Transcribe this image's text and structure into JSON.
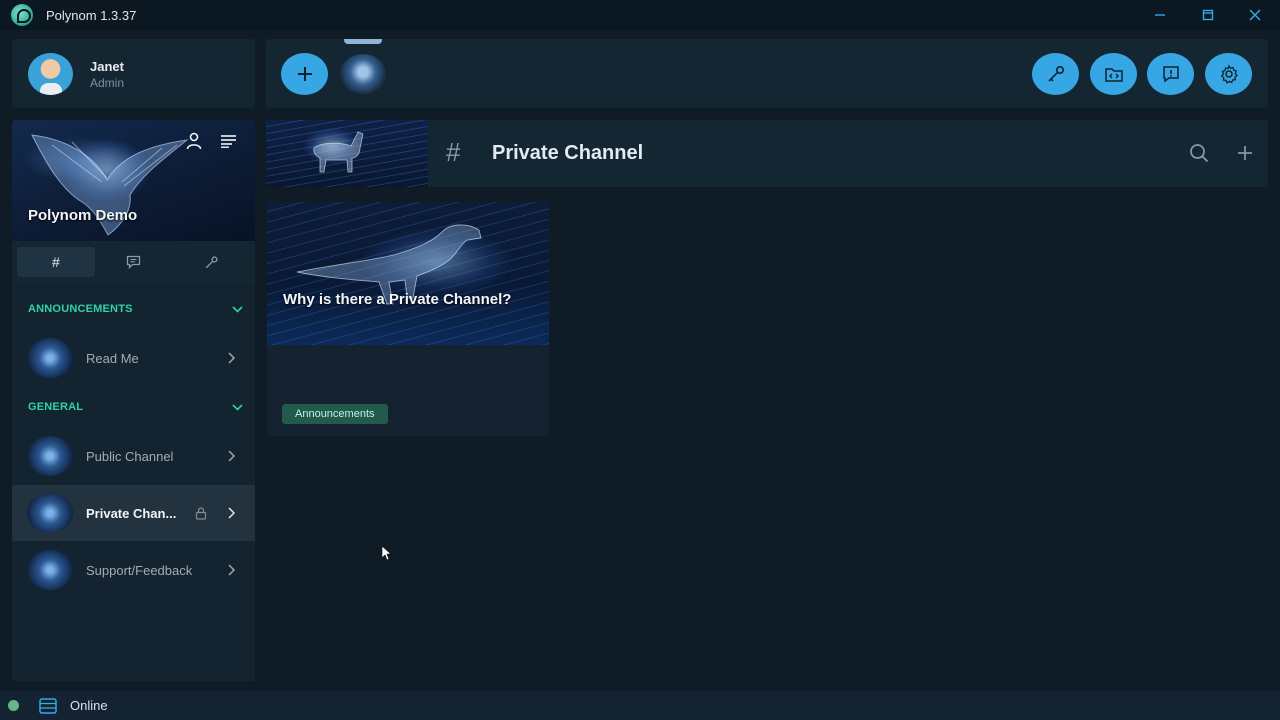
{
  "app": {
    "title": "Polynom 1.3.37",
    "window_controls": [
      "minimize-icon",
      "maximize-icon",
      "close-icon"
    ]
  },
  "profile": {
    "name": "Janet",
    "role": "Admin"
  },
  "topbar": {
    "left_buttons": [
      "plus-icon"
    ],
    "right_buttons": [
      "key-icon",
      "folder-code-icon",
      "feedback-icon",
      "gear-icon"
    ]
  },
  "server": {
    "name": "Polynom Demo",
    "banner_icons": [
      "user-icon",
      "menu-icon"
    ],
    "tabs": [
      {
        "icon": "hash-icon",
        "label": "#",
        "active": true
      },
      {
        "icon": "chat-icon",
        "label": "",
        "active": false
      },
      {
        "icon": "key-icon",
        "label": "",
        "active": false
      }
    ]
  },
  "sidebar": {
    "categories": [
      {
        "name": "ANNOUNCEMENTS",
        "channels": [
          {
            "label": "Read Me",
            "active": false,
            "locked": false
          }
        ]
      },
      {
        "name": "GENERAL",
        "channels": [
          {
            "label": "Public Channel",
            "active": false,
            "locked": false
          },
          {
            "label": "Private Chan...",
            "active": true,
            "locked": true
          },
          {
            "label": "Support/Feedback",
            "active": false,
            "locked": false
          }
        ]
      }
    ]
  },
  "channel": {
    "hash": "#",
    "title": "Private Channel",
    "actions": [
      "search-icon",
      "plus-icon"
    ]
  },
  "posts": [
    {
      "title": "Why is there a Private Channel?",
      "tag": "Announcements"
    }
  ],
  "status": {
    "text": "Online",
    "color": "#66b48a"
  },
  "colors": {
    "accent": "#36a6e4",
    "category": "#2ed3a8",
    "tag_bg": "#245a4c"
  }
}
